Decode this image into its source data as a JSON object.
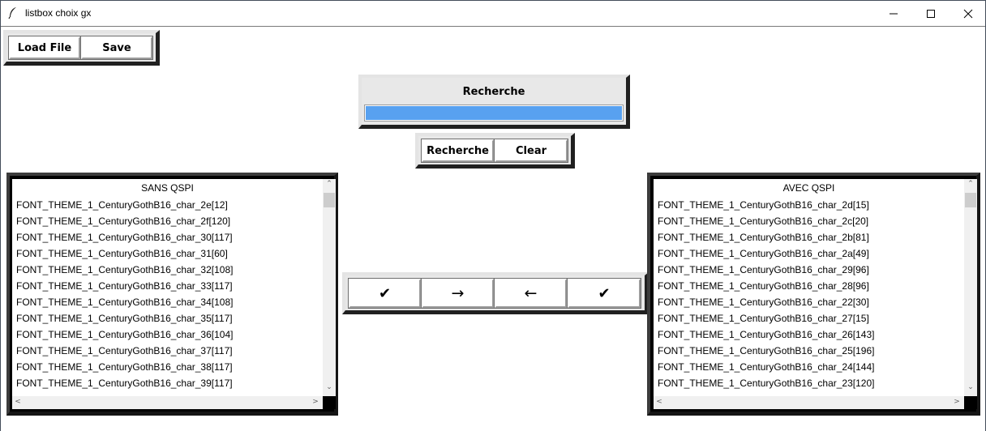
{
  "window": {
    "title": "listbox choix gx",
    "controls": {
      "minimize": "minimize-icon",
      "maximize": "maximize-icon",
      "close": "close-icon"
    }
  },
  "file_buttons": {
    "load": "Load File",
    "save": "Save"
  },
  "search": {
    "label": "Recherche",
    "input_value": "",
    "search_button": "Recherche",
    "clear_button": "Clear",
    "input_color": "#58a1f0"
  },
  "transfer_buttons": [
    "✔",
    "→",
    "←",
    "✔"
  ],
  "left_list": {
    "header": "SANS QSPI",
    "items": [
      "FONT_THEME_1_CenturyGothB16_char_2e[12]",
      "FONT_THEME_1_CenturyGothB16_char_2f[120]",
      "FONT_THEME_1_CenturyGothB16_char_30[117]",
      "FONT_THEME_1_CenturyGothB16_char_31[60]",
      "FONT_THEME_1_CenturyGothB16_char_32[108]",
      "FONT_THEME_1_CenturyGothB16_char_33[117]",
      "FONT_THEME_1_CenturyGothB16_char_34[108]",
      "FONT_THEME_1_CenturyGothB16_char_35[117]",
      "FONT_THEME_1_CenturyGothB16_char_36[104]",
      "FONT_THEME_1_CenturyGothB16_char_37[117]",
      "FONT_THEME_1_CenturyGothB16_char_38[117]",
      "FONT_THEME_1_CenturyGothB16_char_39[117]"
    ]
  },
  "right_list": {
    "header": "AVEC QSPI",
    "items": [
      "FONT_THEME_1_CenturyGothB16_char_2d[15]",
      "FONT_THEME_1_CenturyGothB16_char_2c[20]",
      "FONT_THEME_1_CenturyGothB16_char_2b[81]",
      "FONT_THEME_1_CenturyGothB16_char_2a[49]",
      "FONT_THEME_1_CenturyGothB16_char_29[96]",
      "FONT_THEME_1_CenturyGothB16_char_28[96]",
      "FONT_THEME_1_CenturyGothB16_char_22[30]",
      "FONT_THEME_1_CenturyGothB16_char_27[15]",
      "FONT_THEME_1_CenturyGothB16_char_26[143]",
      "FONT_THEME_1_CenturyGothB16_char_25[196]",
      "FONT_THEME_1_CenturyGothB16_char_24[144]",
      "FONT_THEME_1_CenturyGothB16_char_23[120]"
    ]
  },
  "scroll_glyphs": {
    "up": "⌃",
    "down": "⌄",
    "left": "<",
    "right": ">"
  }
}
